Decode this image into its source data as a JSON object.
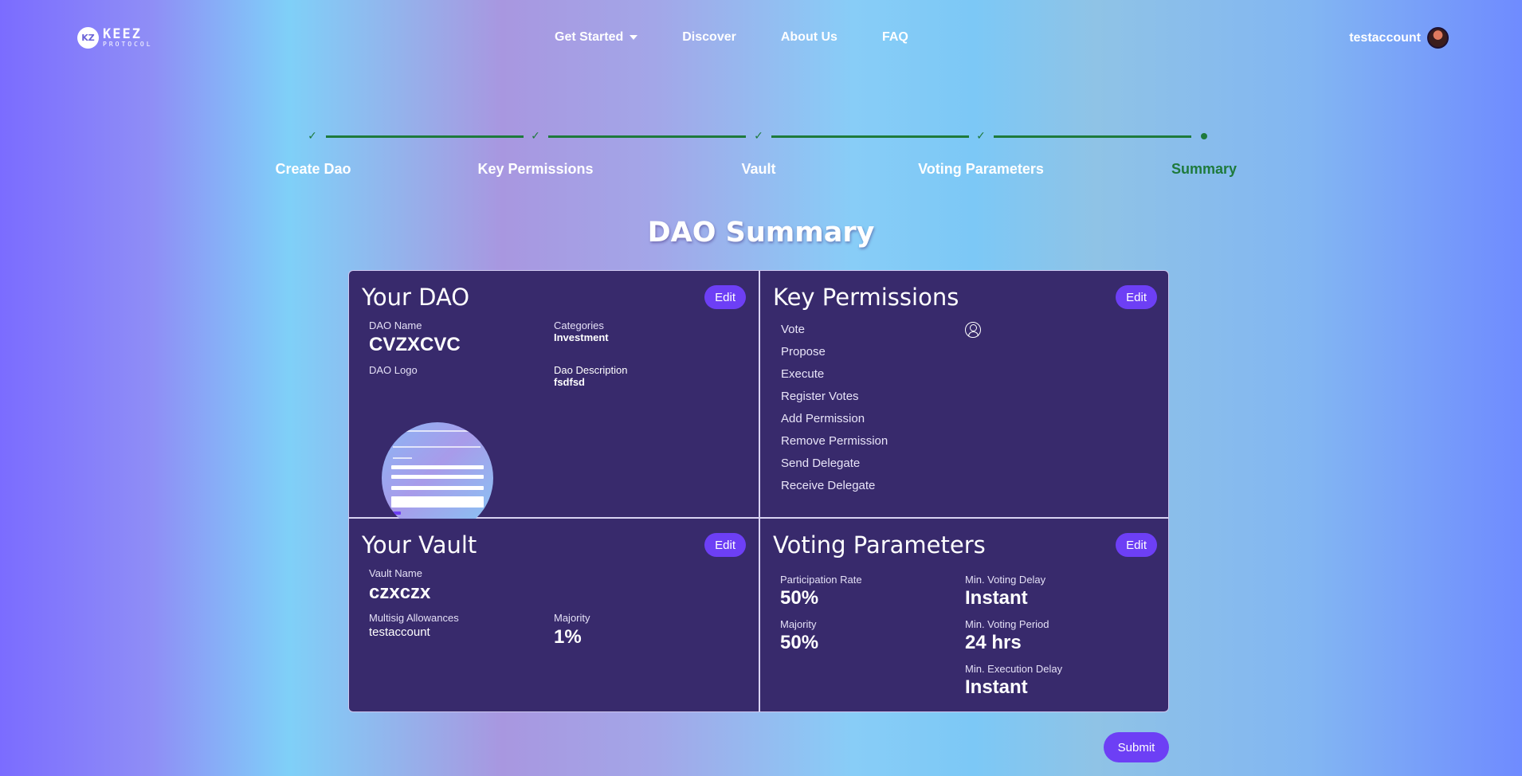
{
  "header": {
    "logo_mark": "KZ",
    "logo_line1": "KEEZ",
    "logo_line2": "PROTOCOL",
    "nav": [
      "Get Started",
      "Discover",
      "About Us",
      "FAQ"
    ],
    "account_name": "testaccount"
  },
  "stepper": {
    "steps": [
      {
        "label": "Create Dao",
        "state": "done"
      },
      {
        "label": "Key Permissions",
        "state": "done"
      },
      {
        "label": "Vault",
        "state": "done"
      },
      {
        "label": "Voting Parameters",
        "state": "done"
      },
      {
        "label": "Summary",
        "state": "active"
      }
    ],
    "check_glyph": "✓"
  },
  "page_title": "DAO Summary",
  "your_dao": {
    "title": "Your DAO",
    "edit_label": "Edit",
    "dao_name_label": "DAO Name",
    "dao_name": "CVZXCVC",
    "categories_label": "Categories",
    "categories": "Investment",
    "logo_label": "DAO Logo",
    "description_label": "Dao Description",
    "description": "fsdfsd"
  },
  "key_permissions": {
    "title": "Key Permissions",
    "edit_label": "Edit",
    "items": [
      "Vote",
      "Propose",
      "Execute",
      "Register Votes",
      "Add Permission",
      "Remove Permission",
      "Send Delegate",
      "Receive Delegate"
    ]
  },
  "your_vault": {
    "title": "Your Vault",
    "edit_label": "Edit",
    "vault_name_label": "Vault Name",
    "vault_name": "czxczx",
    "multisig_label": "Multisig Allowances",
    "multisig": "testaccount",
    "majority_label": "Majority",
    "majority": "1%"
  },
  "voting_parameters": {
    "title": "Voting Parameters",
    "edit_label": "Edit",
    "participation_label": "Participation Rate",
    "participation": "50%",
    "majority_label": "Majority",
    "majority": "50%",
    "min_delay_label": "Min. Voting Delay",
    "min_delay": "Instant",
    "min_period_label": "Min. Voting Period",
    "min_period": "24 hrs",
    "min_exec_label": "Min. Execution Delay",
    "min_exec": "Instant"
  },
  "submit_label": "Submit",
  "colors": {
    "accent": "#6d3ff5",
    "card_bg": "#382a6c",
    "step_green": "#1e7a3c"
  }
}
